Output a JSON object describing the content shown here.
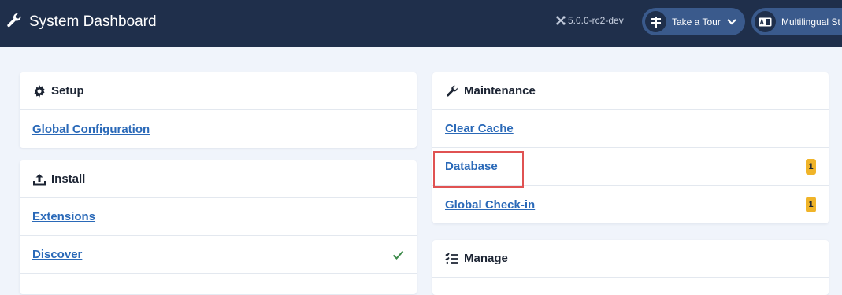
{
  "header": {
    "title": "System Dashboard",
    "version": "5.0.0-rc2-dev",
    "tour_label": "Take a Tour",
    "multilingual_label": "Multilingual St"
  },
  "setup": {
    "title": "Setup",
    "items": [
      {
        "label": "Global Configuration"
      }
    ]
  },
  "install": {
    "title": "Install",
    "items": [
      {
        "label": "Extensions"
      },
      {
        "label": "Discover"
      }
    ]
  },
  "maintenance": {
    "title": "Maintenance",
    "items": [
      {
        "label": "Clear Cache"
      },
      {
        "label": "Database",
        "badge": "1"
      },
      {
        "label": "Global Check-in",
        "badge": "1"
      }
    ]
  },
  "manage": {
    "title": "Manage"
  },
  "colors": {
    "header_bg": "#1f2f4b",
    "link": "#2a69b8",
    "badge": "#f0b429",
    "check": "#3c8a4a",
    "highlight": "#e05252"
  },
  "icons": {
    "header": "wrench-icon",
    "version": "joomla-icon",
    "tour": "signpost-icon",
    "multilingual": "language-icon",
    "setup": "gear-icon",
    "install": "upload-icon",
    "maintenance": "wrench-icon",
    "manage": "list-check-icon",
    "discover_status": "check-icon"
  }
}
